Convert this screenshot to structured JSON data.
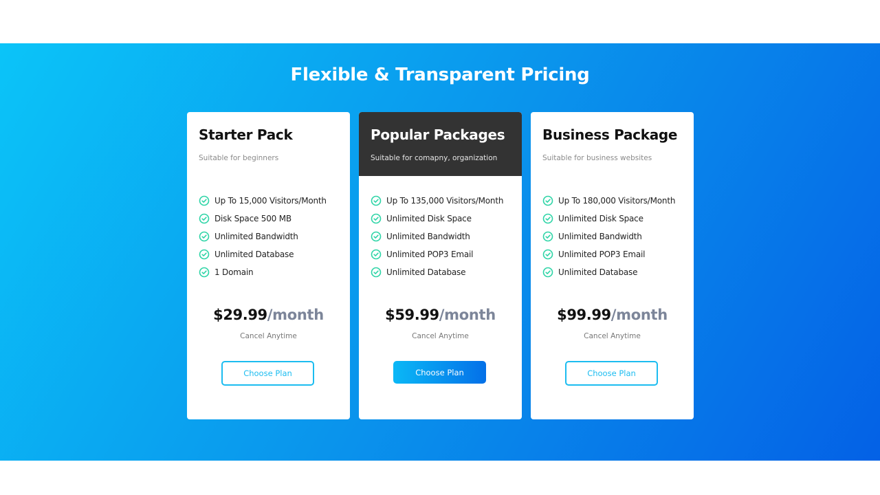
{
  "section": {
    "title": "Flexible & Transparent Pricing"
  },
  "colors": {
    "gradient_start": "#0bc4f8",
    "gradient_end": "#0461e6",
    "check_icon": "#2dd4a6",
    "featured_header": "#333333",
    "button_accent": "#1bbcf0"
  },
  "plans": [
    {
      "name": "Starter Pack",
      "description": "Suitable for beginners",
      "featured": false,
      "features": [
        "Up To 15,000 Visitors/Month",
        "Disk Space 500 MB",
        "Unlimited Bandwidth",
        "Unlimited Database",
        "1 Domain"
      ],
      "price": "$29.99",
      "period": "/month",
      "note": "Cancel Anytime",
      "button_label": "Choose Plan"
    },
    {
      "name": "Popular Packages",
      "description": "Suitable for comapny, organization",
      "featured": true,
      "features": [
        "Up To 135,000 Visitors/Month",
        "Unlimited Disk Space",
        "Unlimited Bandwidth",
        "Unlimited POP3 Email",
        "Unlimited Database"
      ],
      "price": "$59.99",
      "period": "/month",
      "note": "Cancel Anytime",
      "button_label": "Choose Plan"
    },
    {
      "name": "Business Package",
      "description": "Suitable for business websites",
      "featured": false,
      "features": [
        "Up To 180,000 Visitors/Month",
        "Unlimited Disk Space",
        "Unlimited Bandwidth",
        "Unlimited POP3 Email",
        "Unlimited Database"
      ],
      "price": "$99.99",
      "period": "/month",
      "note": "Cancel Anytime",
      "button_label": "Choose Plan"
    }
  ],
  "icons": {
    "feature_bullet": "check-circle-icon"
  }
}
